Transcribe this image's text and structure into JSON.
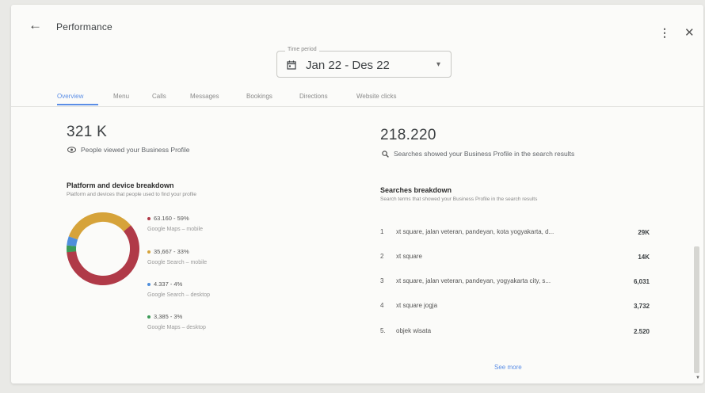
{
  "header": {
    "title": "Performance",
    "back_icon": "arrow-left-icon",
    "more_icon": "more-vert-icon",
    "close_icon": "close-icon"
  },
  "time_period": {
    "label": "Time period",
    "value": "Jan 22 - Des 22"
  },
  "tabs": [
    {
      "label": "Overview",
      "active": true
    },
    {
      "label": "Menu"
    },
    {
      "label": "Calls"
    },
    {
      "label": "Messages"
    },
    {
      "label": "Bookings"
    },
    {
      "label": "Directions"
    },
    {
      "label": "Website clicks"
    }
  ],
  "left": {
    "total": "321 K",
    "caption": "People viewed your Business Profile",
    "breakdown_title": "Platform and device breakdown",
    "breakdown_sub": "Platform and devices that people used to find your profile",
    "items": [
      {
        "value": "63.160 - 59%",
        "label": "Google Maps – mobile",
        "color": "#b03a48",
        "share": 59
      },
      {
        "value": "35,667 - 33%",
        "label": "Google Search – mobile",
        "color": "#d6a33a",
        "share": 33
      },
      {
        "value": "4.337 - 4%",
        "label": "Google Search – desktop",
        "color": "#4f8edc",
        "share": 4
      },
      {
        "value": "3,385 - 3%",
        "label": "Google Maps – desktop",
        "color": "#3b9a57",
        "share": 3
      }
    ]
  },
  "right": {
    "total": "218.220",
    "caption": "Searches showed your Business Profile in the search results",
    "breakdown_title": "Searches breakdown",
    "breakdown_sub": "Search terms that showed your Business Profile in the search results",
    "rows": [
      {
        "rank": "1",
        "term": "xt square, jalan veteran, pandeyan, kota yogyakarta, d...",
        "count": "29K"
      },
      {
        "rank": "2",
        "term": "xt square",
        "count": "14K"
      },
      {
        "rank": "3",
        "term": "xt square, jalan veteran, pandeyan, yogyakarta city, s...",
        "count": "6,031"
      },
      {
        "rank": "4",
        "term": "xt square jogja",
        "count": "3,732"
      },
      {
        "rank": "5.",
        "term": "objek wisata",
        "count": "2.520"
      }
    ],
    "see_more": "See more"
  }
}
